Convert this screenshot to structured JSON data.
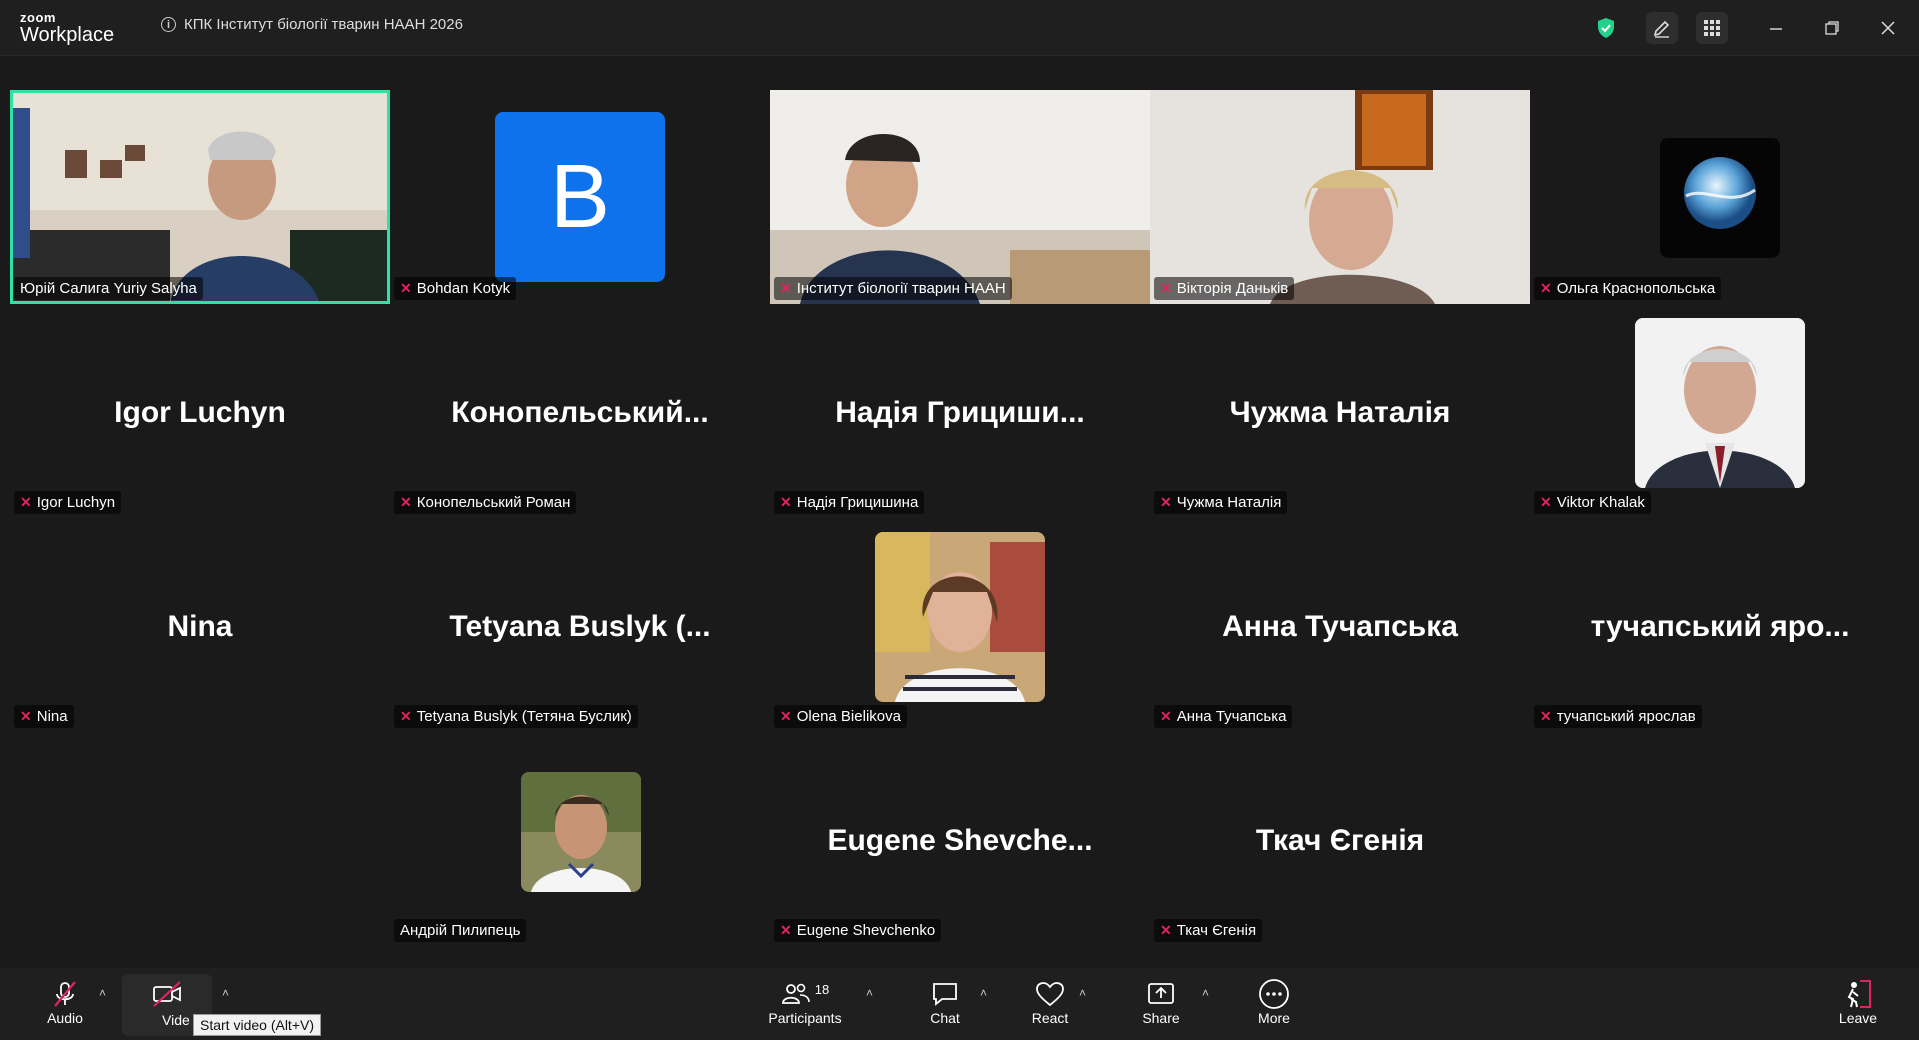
{
  "window": {
    "brand_top": "zoom",
    "brand_bottom": "Workplace",
    "meeting_title": "КПК Інститут біології тварин НААН 2026"
  },
  "participants": [
    {
      "label": "Юрій Салига Yuriy Salyha",
      "muted": false,
      "type": "video",
      "active": true
    },
    {
      "label": "Bohdan Kotyk",
      "muted": true,
      "type": "initial",
      "initial": "B",
      "avatar_color": "#0e72ed"
    },
    {
      "label": "Інститут біології тварин НААН",
      "muted": true,
      "type": "video"
    },
    {
      "label": "Вікторія Даньків",
      "muted": true,
      "type": "video"
    },
    {
      "label": "Ольга Краснопольська",
      "muted": true,
      "type": "globe"
    },
    {
      "label": "Igor Luchyn",
      "muted": true,
      "type": "name",
      "display": "Igor Luchyn"
    },
    {
      "label": "Конопельський Роман",
      "muted": true,
      "type": "name",
      "display": "Конопельський..."
    },
    {
      "label": "Надія Грицишина",
      "muted": true,
      "type": "name",
      "display": "Надія Грициши..."
    },
    {
      "label": "Чужма Наталія",
      "muted": true,
      "type": "name",
      "display": "Чужма Наталія"
    },
    {
      "label": "Viktor Khalak",
      "muted": true,
      "type": "photo"
    },
    {
      "label": "Nina",
      "muted": true,
      "type": "name",
      "display": "Nina"
    },
    {
      "label": "Tetyana Buslyk (Тетяна Буслик)",
      "muted": true,
      "type": "name",
      "display": "Tetyana Buslyk (..."
    },
    {
      "label": "Olena Bielikova",
      "muted": true,
      "type": "photo"
    },
    {
      "label": "Анна Тучапська",
      "muted": true,
      "type": "name",
      "display": "Анна Тучапська"
    },
    {
      "label": "тучапський ярослав",
      "muted": true,
      "type": "name",
      "display": "тучапський яро..."
    },
    {
      "label": "Андрій Пилипець",
      "muted": false,
      "type": "photo"
    },
    {
      "label": "Eugene Shevchenko",
      "muted": true,
      "type": "name",
      "display": "Eugene Shevche..."
    },
    {
      "label": "Ткач Єгенія",
      "muted": true,
      "type": "name",
      "display": "Ткач Єгенія"
    }
  ],
  "toolbar": {
    "audio": "Audio",
    "video": "Vide",
    "participants": "Participants",
    "participants_count": "18",
    "chat": "Chat",
    "react": "React",
    "share": "Share",
    "more": "More",
    "leave": "Leave",
    "tooltip": "Start video (Alt+V)"
  },
  "colors": {
    "background": "#1a1a1a",
    "active_speaker": "#2de3a3",
    "muted_icon": "#e0245e",
    "leave": "#e0245e"
  }
}
